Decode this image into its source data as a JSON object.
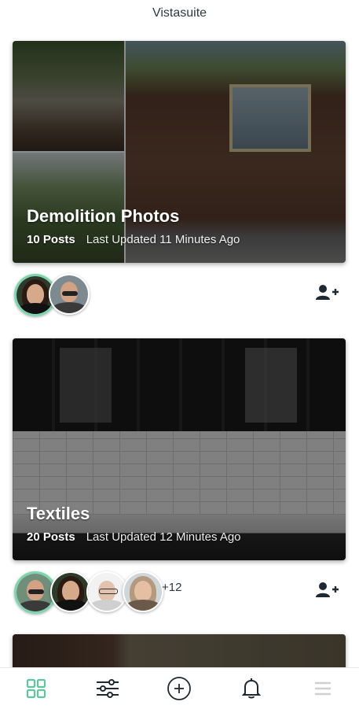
{
  "app": {
    "title": "Vistasuite"
  },
  "albums": [
    {
      "title": "Demolition Photos",
      "posts": "10 Posts",
      "updated": "Last Updated 11 Minutes Ago",
      "members": [
        "woman-dark-hair",
        "man-sunglasses"
      ],
      "more": ""
    },
    {
      "title": "Textiles",
      "posts": "20 Posts",
      "updated": "Last Updated 12 Minutes Ago",
      "members": [
        "man-sunglasses",
        "woman-dark-hair",
        "man-glasses",
        "woman-light-hair"
      ],
      "more": "+12"
    },
    {
      "title": "",
      "posts": "",
      "updated": ""
    }
  ],
  "nav": {
    "items": [
      "grid-icon",
      "sliders-icon",
      "add-circle-icon",
      "bell-icon",
      "menu-icon"
    ],
    "active": "grid-icon"
  },
  "colors": {
    "accent": "#5cc79a",
    "owner_ring": "#7bd6ad",
    "text": "#1f2a33",
    "nav_inactive": "#1d2a33",
    "nav_disabled": "#d0d0d0"
  }
}
